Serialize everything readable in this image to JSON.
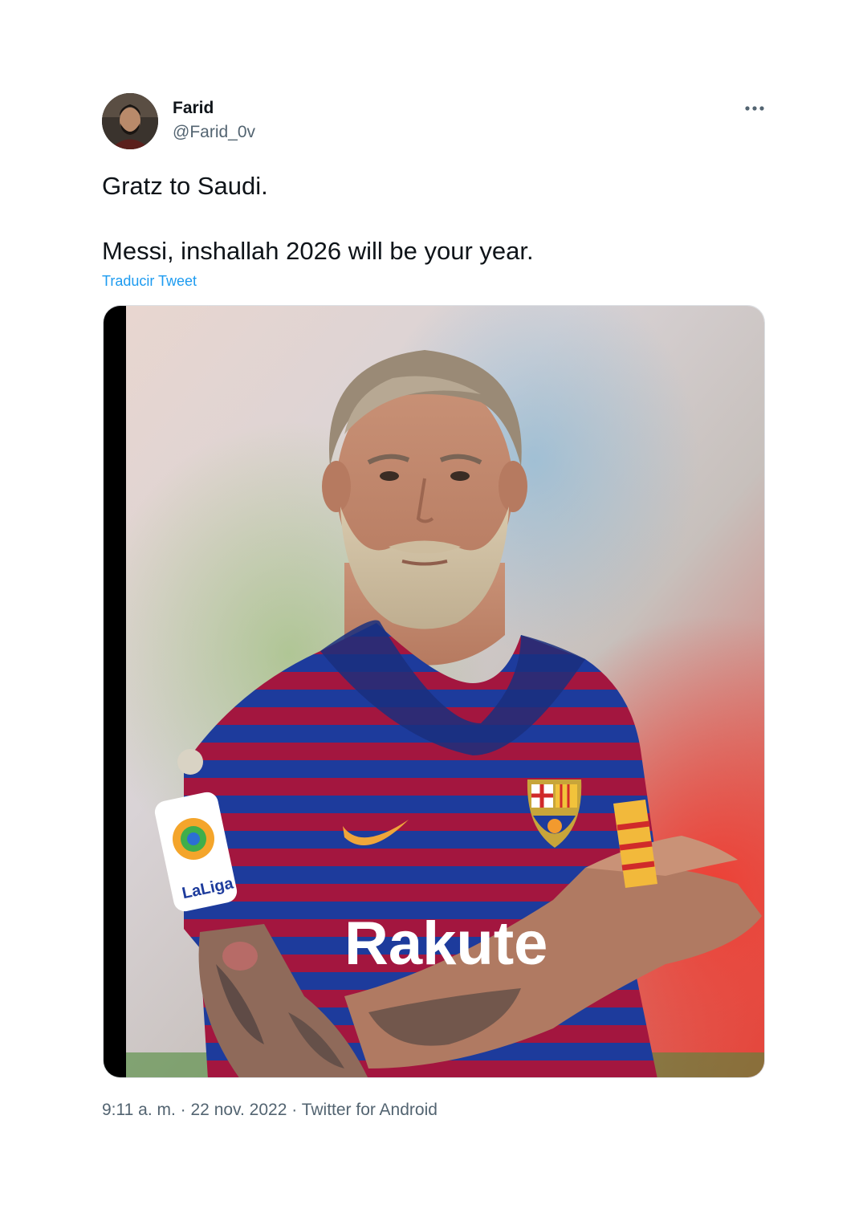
{
  "author": {
    "display_name": "Farid",
    "handle": "@Farid_0v"
  },
  "tweet": {
    "line_1": "Gratz to Saudi.",
    "line_2": "Messi, inshallah 2026 will be your year.",
    "translate_label": "Traducir Tweet",
    "media_text": {
      "sponsor": "Rakute",
      "sleeve_badge": "LaLiga"
    }
  },
  "meta": {
    "time": "9:11 a. m.",
    "separator": " · ",
    "date": "22 nov. 2022",
    "source": "Twitter for Android"
  },
  "icons": {
    "more": "more-horizontal-icon"
  },
  "colors": {
    "text_primary": "#0f1419",
    "text_secondary": "#536471",
    "link": "#1d9bf0",
    "jersey_blue": "#1d3b9c",
    "jersey_red": "#a3163f"
  }
}
